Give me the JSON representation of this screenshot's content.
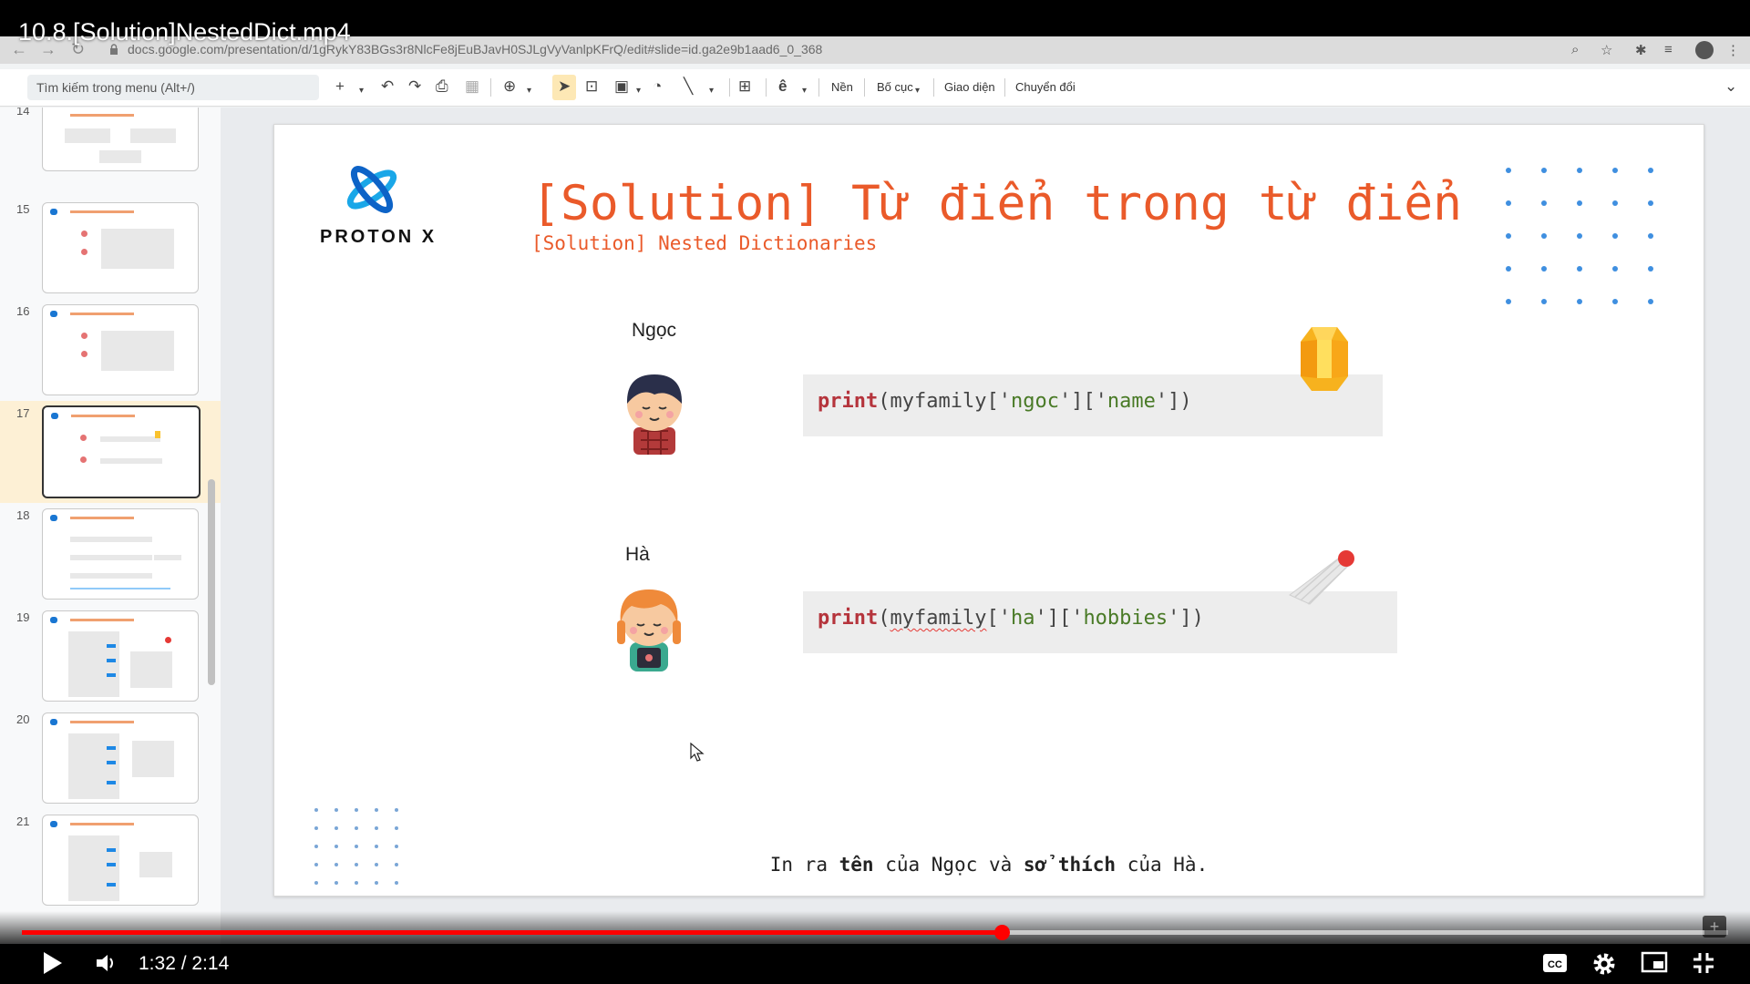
{
  "video": {
    "title": "10.8.[Solution]NestedDict.mp4",
    "time": "1:32 / 2:14",
    "progress": 0.574,
    "buffered": 0.986
  },
  "browser": {
    "url": "docs.google.com/presentation/d/1gRykY83BGs3r8NlcFe8jEuBJavH0SJLgVyVanlpKFrQ/edit#slide=id.ga2e9b1aad6_0_368"
  },
  "toolbar": {
    "menu_search_placeholder": "Tìm kiếm trong menu (Alt+/)",
    "background_label": "Nền",
    "layout_label": "Bố cục",
    "theme_label": "Giao diện",
    "transition_label": "Chuyển đổi"
  },
  "filmstrip": {
    "slides": [
      {
        "number": "14"
      },
      {
        "number": "15"
      },
      {
        "number": "16"
      },
      {
        "number": "17",
        "active": true
      },
      {
        "number": "18"
      },
      {
        "number": "19"
      },
      {
        "number": "20"
      },
      {
        "number": "21"
      }
    ]
  },
  "slide": {
    "logo_text": "PROTON X",
    "title": "[Solution] Từ điển trong từ điển",
    "subtitle": "[Solution] Nested Dictionaries",
    "people": [
      {
        "name": "Ngọc",
        "code": {
          "func": "print",
          "var": "myfamily",
          "key1": "ngoc",
          "key2": "name"
        }
      },
      {
        "name": "Hà",
        "code": {
          "func": "print",
          "var": "myfamily",
          "key1": "ha",
          "key2": "hobbies"
        }
      }
    ],
    "caption": {
      "p1": "In ra ",
      "b1": "tên",
      "p2": " của Ngọc và ",
      "b2": "sở thích",
      "p3": " của Hà."
    }
  },
  "icons": {
    "crystal": "gem-icon",
    "shuttlecock": "shuttlecock-icon"
  },
  "colors": {
    "accent": "#ea5a2a",
    "progress": "#ff0000",
    "code_keyword": "#b5343c",
    "code_string": "#497a26"
  }
}
